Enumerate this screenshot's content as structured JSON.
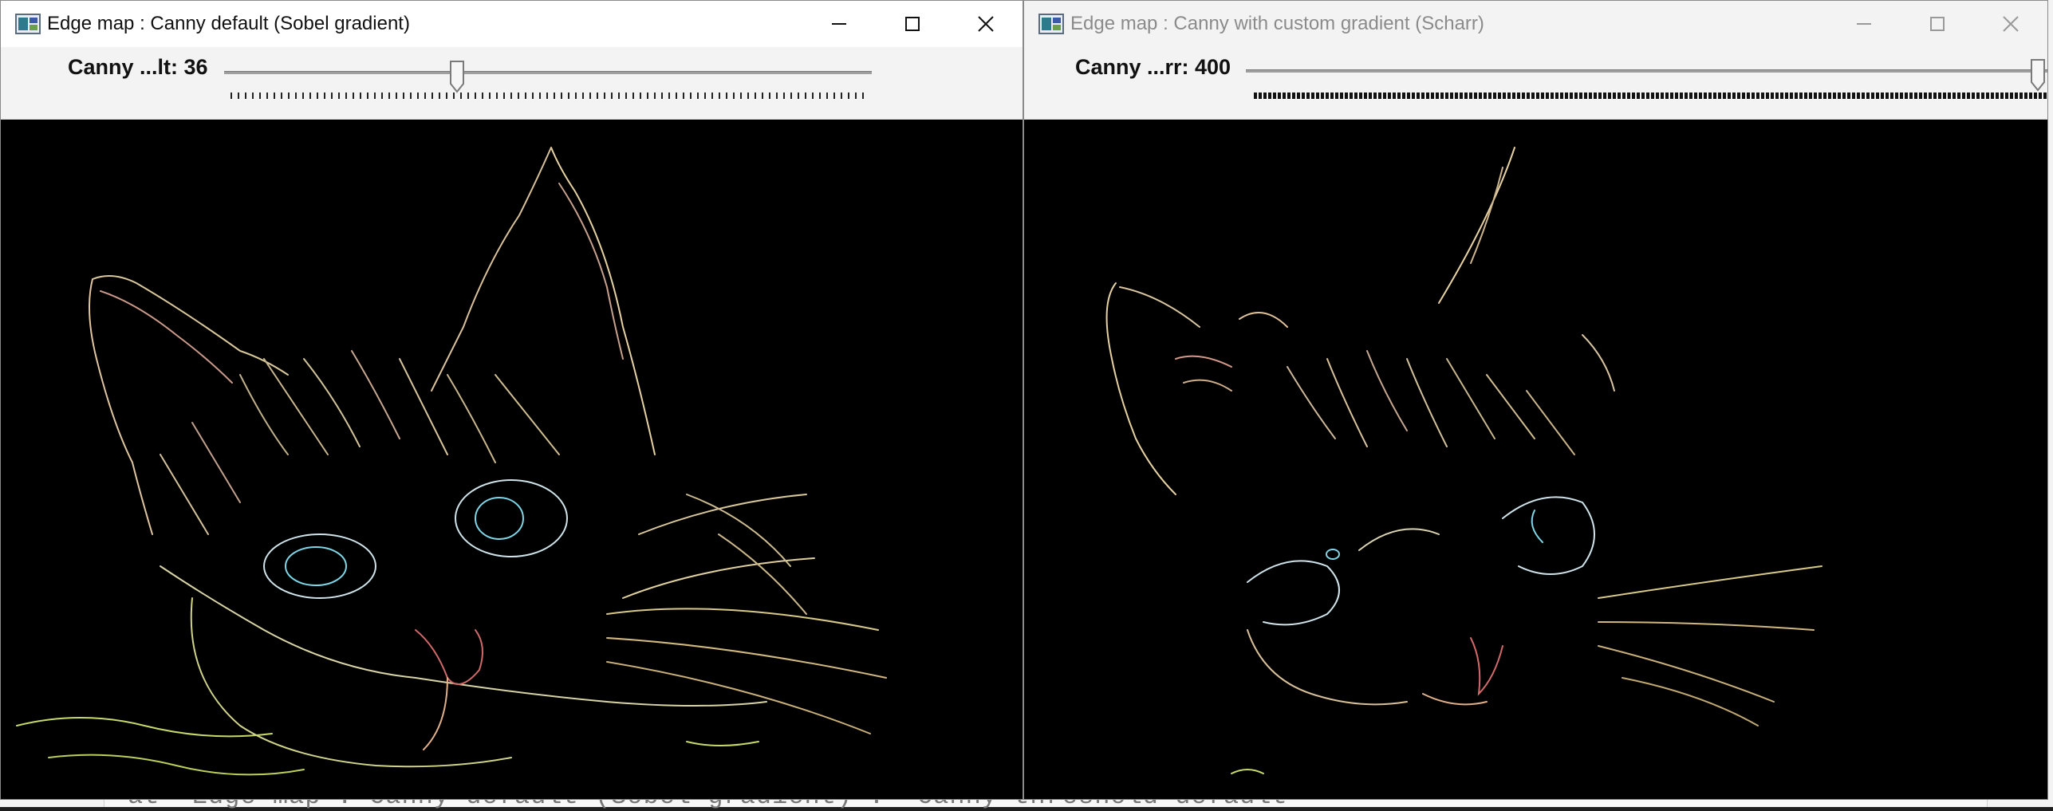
{
  "background_console": {
    "text": "at 'Edge map : Canny default (Sobel gradient)': 'Canny threshold default'"
  },
  "left_window": {
    "title": "Edge map : Canny default (Sobel gradient)",
    "trackbar_label": "Canny ...lt: 36",
    "trackbar_value": 36,
    "trackbar_fraction": 0.36,
    "buttons": {
      "minimize": "minimize-icon",
      "maximize": "maximize-icon",
      "close": "close-icon"
    }
  },
  "right_window": {
    "title": "Edge map : Canny with custom gradient (Scharr)",
    "trackbar_label": "Canny ...rr: 400",
    "trackbar_value": 400,
    "trackbar_fraction": 1.0,
    "buttons": {
      "minimize": "minimize-icon",
      "maximize": "maximize-icon",
      "close": "close-icon"
    }
  },
  "colors": {
    "edge_warm": "#e7d7a8",
    "edge_pink": "#d06a6a",
    "edge_cyan": "#7fd6e6",
    "edge_green": "#c8d96a"
  }
}
